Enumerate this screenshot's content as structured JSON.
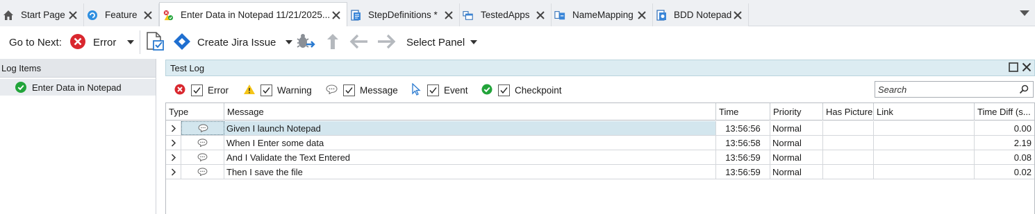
{
  "tabs": [
    {
      "label": "Start Page",
      "icon": "home-icon",
      "active": false
    },
    {
      "label": "Feature",
      "icon": "feature-icon",
      "active": false
    },
    {
      "label": "Enter Data in Notepad 11/21/2025...",
      "icon": "test-log-icon",
      "active": true
    },
    {
      "label": "StepDefinitions *",
      "icon": "script-file-icon",
      "active": false
    },
    {
      "label": "TestedApps",
      "icon": "tested-apps-icon",
      "active": false
    },
    {
      "label": "NameMapping",
      "icon": "name-mapping-icon",
      "active": false
    },
    {
      "label": "BDD Notepad",
      "icon": "bdd-project-icon",
      "active": false
    }
  ],
  "toolbar": {
    "goto_label": "Go to Next:",
    "goto_value": "Error",
    "jira_label": "Create Jira Issue",
    "select_panel_label": "Select Panel"
  },
  "left_panel": {
    "title": "Log Items",
    "items": [
      {
        "label": "Enter Data in Notepad",
        "status": "passed"
      }
    ]
  },
  "test_log": {
    "title": "Test Log",
    "filters": [
      {
        "label": "Error",
        "checked": true,
        "icon": "error-icon"
      },
      {
        "label": "Warning",
        "checked": true,
        "icon": "warning-icon"
      },
      {
        "label": "Message",
        "checked": true,
        "icon": "message-icon"
      },
      {
        "label": "Event",
        "checked": true,
        "icon": "event-icon"
      },
      {
        "label": "Checkpoint",
        "checked": true,
        "icon": "checkpoint-icon"
      }
    ],
    "search_placeholder": "Search",
    "columns": [
      "Type",
      "Message",
      "Time",
      "Priority",
      "Has Picture",
      "Link",
      "Time Diff (s..."
    ],
    "rows": [
      {
        "message": "Given I launch Notepad",
        "time": "13:56:56",
        "priority": "Normal",
        "has_picture": "",
        "link": "",
        "time_diff": "0.00",
        "selected": true
      },
      {
        "message": "When I Enter some data",
        "time": "13:56:58",
        "priority": "Normal",
        "has_picture": "",
        "link": "",
        "time_diff": "2.19",
        "selected": false
      },
      {
        "message": "And I Validate the Text Entered",
        "time": "13:56:59",
        "priority": "Normal",
        "has_picture": "",
        "link": "",
        "time_diff": "0.08",
        "selected": false
      },
      {
        "message": "Then I save the file",
        "time": "13:56:59",
        "priority": "Normal",
        "has_picture": "",
        "link": "",
        "time_diff": "0.02",
        "selected": false
      }
    ]
  },
  "colors": {
    "accent": "#d9272e",
    "jira_blue": "#1f6fd0",
    "checkpoint_green": "#22a43a",
    "header_band": "#dcecf2"
  }
}
